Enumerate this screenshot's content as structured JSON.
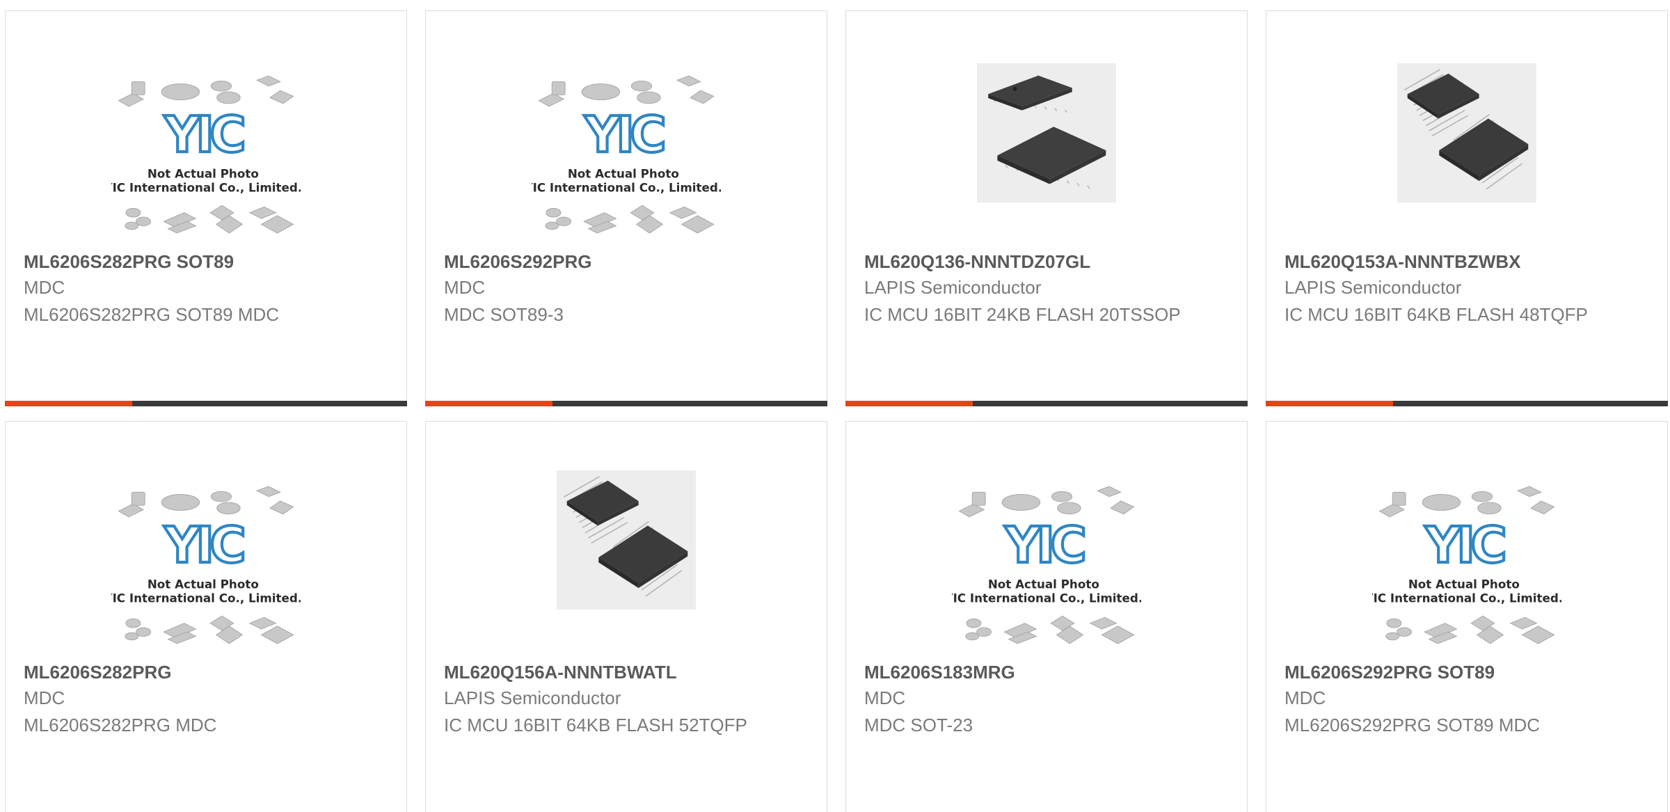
{
  "accent_color": "#e8421b",
  "bar_color": "#3a3a3a",
  "placeholder": {
    "logo_text": "YIC",
    "line1": "Not Actual Photo",
    "line2": "YIC International Co., Limited."
  },
  "products": [
    {
      "title": "ML6206S282PRG SOT89",
      "brand": "MDC",
      "desc": "ML6206S282PRG SOT89 MDC",
      "image": "yic-placeholder-icon"
    },
    {
      "title": "ML6206S292PRG",
      "brand": "MDC",
      "desc": "MDC SOT89-3",
      "image": "yic-placeholder-icon"
    },
    {
      "title": "ML620Q136-NNNTDZ07GL",
      "brand": "LAPIS Semiconductor",
      "desc": "IC MCU 16BIT 24KB FLASH 20TSSOP",
      "image": "tssop-chip-icon"
    },
    {
      "title": "ML620Q153A-NNNTBZWBX",
      "brand": "LAPIS Semiconductor",
      "desc": "IC MCU 16BIT 64KB FLASH 48TQFP",
      "image": "tqfp-chip-icon"
    },
    {
      "title": "ML6206S282PRG",
      "brand": "MDC",
      "desc": "ML6206S282PRG MDC",
      "image": "yic-placeholder-icon"
    },
    {
      "title": "ML620Q156A-NNNTBWATL",
      "brand": "LAPIS Semiconductor",
      "desc": "IC MCU 16BIT 64KB FLASH 52TQFP",
      "image": "tqfp-chip-icon"
    },
    {
      "title": "ML6206S183MRG",
      "brand": "MDC",
      "desc": "MDC SOT-23",
      "image": "yic-placeholder-icon"
    },
    {
      "title": "ML6206S292PRG SOT89",
      "brand": "MDC",
      "desc": "ML6206S292PRG SOT89 MDC",
      "image": "yic-placeholder-icon"
    }
  ]
}
